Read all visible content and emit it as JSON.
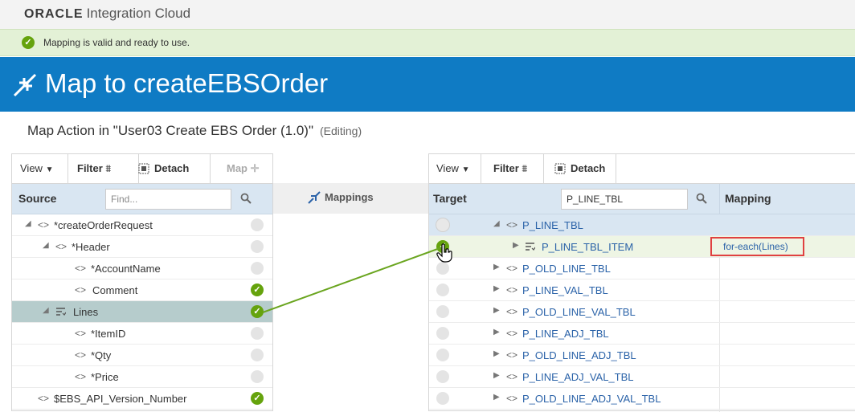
{
  "brand": {
    "name": "ORACLE",
    "product": "Integration Cloud"
  },
  "status": {
    "message": "Mapping is valid and ready to use."
  },
  "page": {
    "title": "Map to createEBSOrder",
    "action": "Map Action in \"User03 Create EBS Order (1.0)\"",
    "editing": "(Editing)"
  },
  "source_panel": {
    "toolbar": {
      "view": "View",
      "filter": "Filter",
      "detach": "Detach",
      "map": "Map"
    },
    "header_label": "Source",
    "search_placeholder": "Find...",
    "rows": [
      {
        "label": "*createOrderRequest",
        "mapped": false
      },
      {
        "label": "*Header",
        "mapped": false
      },
      {
        "label": "*AccountName",
        "mapped": false
      },
      {
        "label": "Comment",
        "mapped": true
      },
      {
        "label": "Lines",
        "mapped": true,
        "selected": true
      },
      {
        "label": "*ItemID",
        "mapped": false
      },
      {
        "label": "*Qty",
        "mapped": false
      },
      {
        "label": "*Price",
        "mapped": false
      },
      {
        "label": "$EBS_API_Version_Number",
        "mapped": true
      }
    ]
  },
  "mappings_column": {
    "label": "Mappings"
  },
  "target_panel": {
    "toolbar": {
      "view": "View",
      "filter": "Filter",
      "detach": "Detach"
    },
    "header_label": "Target",
    "search_value": "P_LINE_TBL",
    "mapping_header": "Mapping",
    "rows": [
      {
        "label": "P_LINE_TBL",
        "mapped": false
      },
      {
        "label": "P_LINE_TBL_ITEM",
        "mapped": true,
        "mapping": "for-each(Lines)"
      },
      {
        "label": "P_OLD_LINE_TBL",
        "mapped": false
      },
      {
        "label": "P_LINE_VAL_TBL",
        "mapped": false
      },
      {
        "label": "P_OLD_LINE_VAL_TBL",
        "mapped": false
      },
      {
        "label": "P_LINE_ADJ_TBL",
        "mapped": false
      },
      {
        "label": "P_OLD_LINE_ADJ_TBL",
        "mapped": false
      },
      {
        "label": "P_LINE_ADJ_VAL_TBL",
        "mapped": false
      },
      {
        "label": "P_OLD_LINE_ADJ_VAL_TBL",
        "mapped": false
      }
    ]
  },
  "colors": {
    "banner": "#0f7bc4",
    "ok": "#65a30d",
    "connector": "#6aa51f",
    "highlight": "#e04141"
  }
}
